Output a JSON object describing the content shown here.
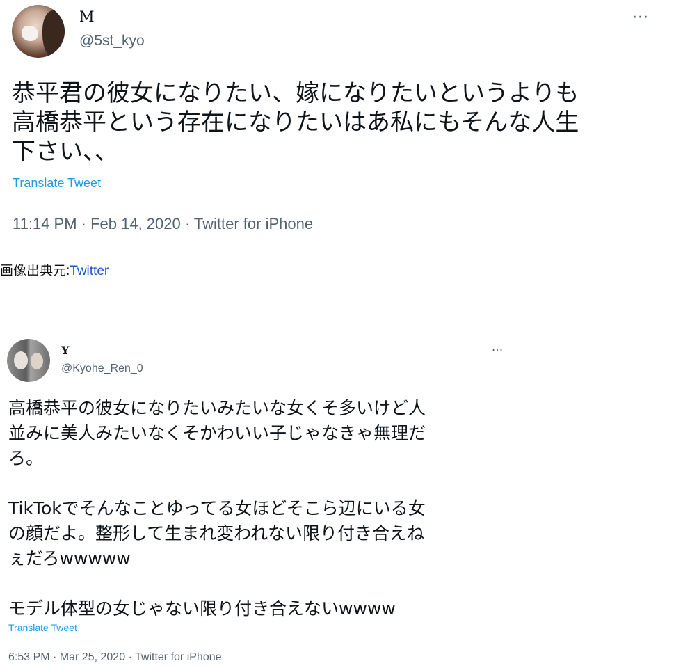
{
  "tweet1": {
    "name": "M",
    "handle": "@5st_kyo",
    "more_label": "···",
    "body": "恭平君の彼女になりたい、嫁になりたいというよりも\n高橋恭平という存在になりたいはあ私にもそんな人生\n下さい、、",
    "translate_label": "Translate Tweet",
    "meta": "11:14 PM · Feb 14, 2020 · Twitter for iPhone"
  },
  "caption": {
    "prefix": "画像出典元:",
    "link_text": "Twitter"
  },
  "tweet2": {
    "name": "Y",
    "handle": "@Kyohe_Ren_0",
    "more_label": "···",
    "body": "高橋恭平の彼女になりたいみたいな女くそ多いけど人\n並みに美人みたいなくそかわいい子じゃなきゃ無理だ\nろ。\n\nTikTokでそんなことゆってる女ほどそこら辺にいる女\nの顔だよ。整形して生まれ変われない限り付き合えね\nぇだろwwwww\n\nモデル体型の女じゃない限り付き合えないwwww",
    "translate_label": "Translate Tweet",
    "meta": "6:53 PM · Mar 25, 2020 · Twitter for iPhone"
  },
  "colors": {
    "link_blue": "#1d9bf0",
    "secondary_gray": "#536471",
    "caption_link": "#1a55d6"
  }
}
